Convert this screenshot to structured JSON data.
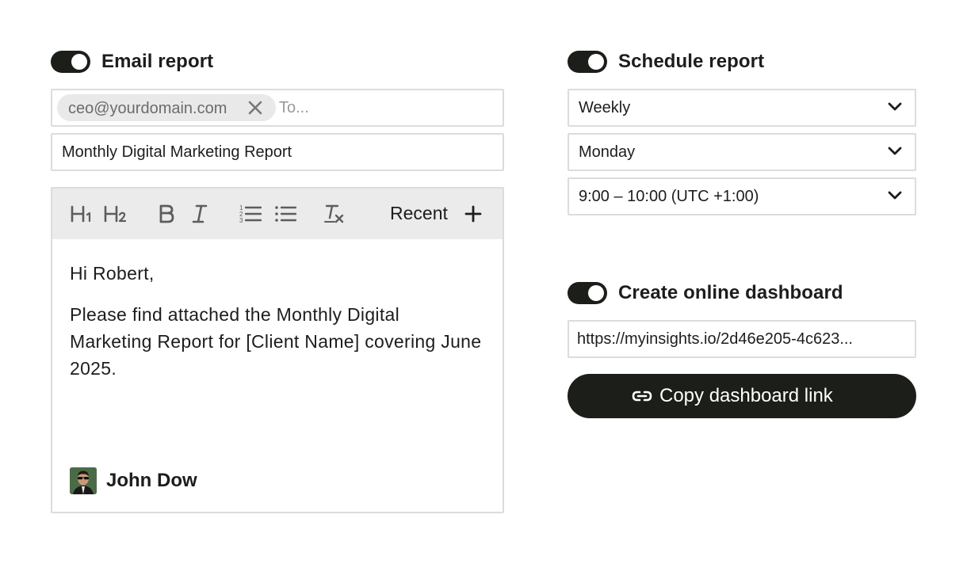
{
  "email_report": {
    "title": "Email report",
    "recipient_chip": "ceo@yourdomain.com",
    "to_placeholder": "To...",
    "subject": "Monthly Digital Marketing Report",
    "toolbar": {
      "recent_label": "Recent",
      "icons": [
        "heading-1-icon",
        "heading-2-icon",
        "bold-icon",
        "italic-icon",
        "numbered-list-icon",
        "bullet-list-icon",
        "clear-format-icon",
        "plus-icon"
      ]
    },
    "body_greeting": "Hi Robert,",
    "body_paragraph": "Please find attached the Monthly Digital Marketing Report for [Client Name] covering June 2025.",
    "signer_name": "John Dow"
  },
  "schedule_report": {
    "title": "Schedule report",
    "frequency": "Weekly",
    "day": "Monday",
    "time": "9:00 – 10:00 (UTC +1:00)"
  },
  "online_dashboard": {
    "title": "Create online dashboard",
    "url": "https://myinsights.io/2d46e205-4c623...",
    "copy_label": "Copy dashboard link"
  },
  "colors": {
    "accent_dark": "#1b1e19",
    "border": "#dcdcdc",
    "toolbar_bg": "#ebebeb",
    "chip_bg": "#e9e9e9"
  }
}
